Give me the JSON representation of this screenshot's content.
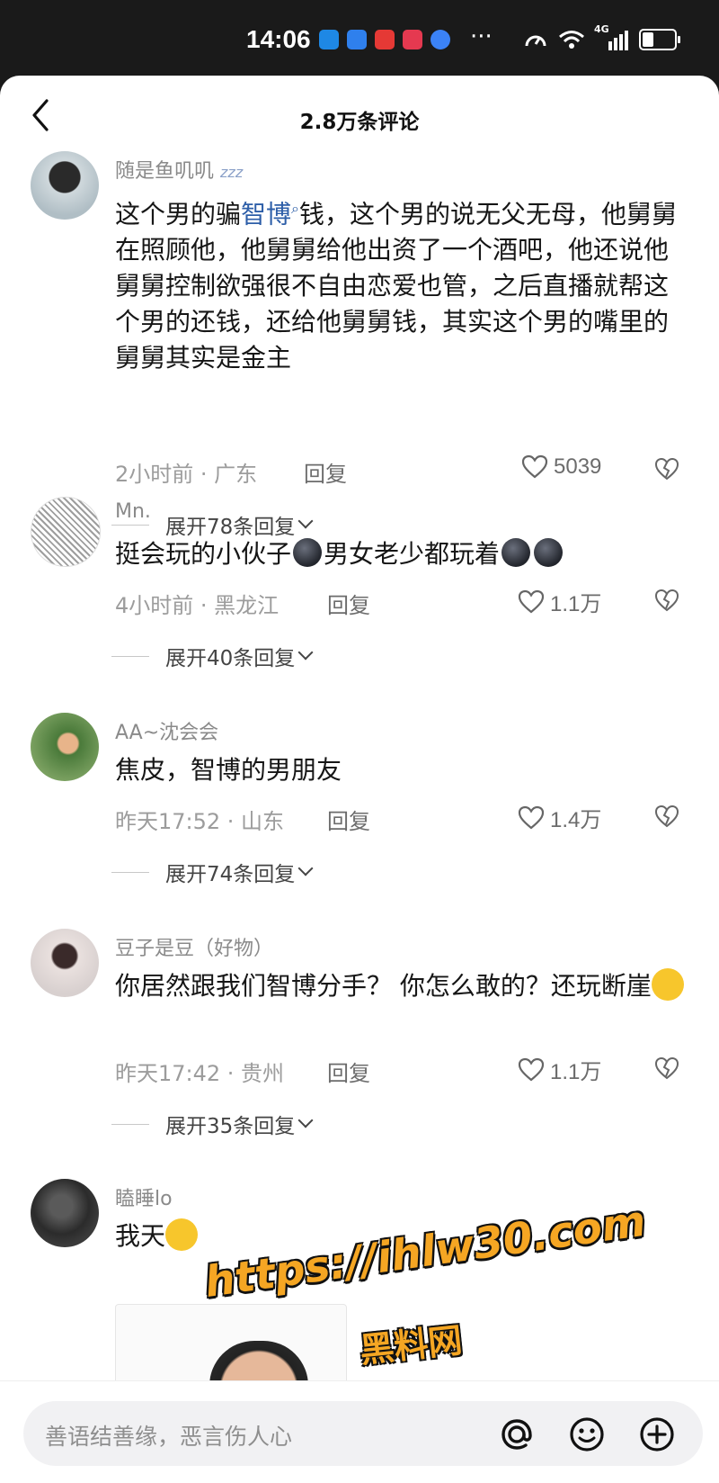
{
  "status_bar": {
    "time": "14:06",
    "dots": "···",
    "network": "4G"
  },
  "header": {
    "title": "2.8万条评论"
  },
  "comments": [
    {
      "username": "随是鱼叽叽",
      "text_before": "这个男的骗",
      "text_highlight": "智博",
      "text_after": "钱，这个男的说无父无母，他舅舅在照顾他，他舅舅给他出资了一个酒吧，他还说他舅舅控制欲强很不自由恋爱也管，之后直播就帮这个男的还钱，还给他舅舅钱，其实这个男的嘴里的舅舅其实是金主",
      "meta": "2小时前 · 广东",
      "reply": "回复",
      "likes": "5039",
      "expand": "展开78条回复"
    },
    {
      "username": "Mn.",
      "text_part1": "挺会玩的小伙子",
      "text_part2": "男女老少都玩着",
      "meta": "4小时前 · 黑龙江",
      "reply": "回复",
      "likes": "1.1万",
      "expand": "展开40条回复"
    },
    {
      "username": "AA~沈会会",
      "text": "焦皮，智博的男朋友",
      "meta": "昨天17:52 · 山东",
      "reply": "回复",
      "likes": "1.4万",
      "expand": "展开74条回复"
    },
    {
      "username": "豆子是豆（好物）",
      "text": "你居然跟我们智博分手？ 你怎么敢的？还玩断崖",
      "meta": "昨天17:42 · 贵州",
      "reply": "回复",
      "likes": "1.1万",
      "expand": "展开35条回复"
    },
    {
      "username": "瞌睡lo",
      "text": "我天"
    }
  ],
  "watermark": {
    "url": "https://ihlw30.com",
    "name": "黑料网"
  },
  "bottom_bar": {
    "placeholder": "善语结善缘，恶言伤人心"
  },
  "colors": {
    "accent": "#2d5ea8",
    "watermark": "#f5a623",
    "sheet": "#ffffff"
  }
}
